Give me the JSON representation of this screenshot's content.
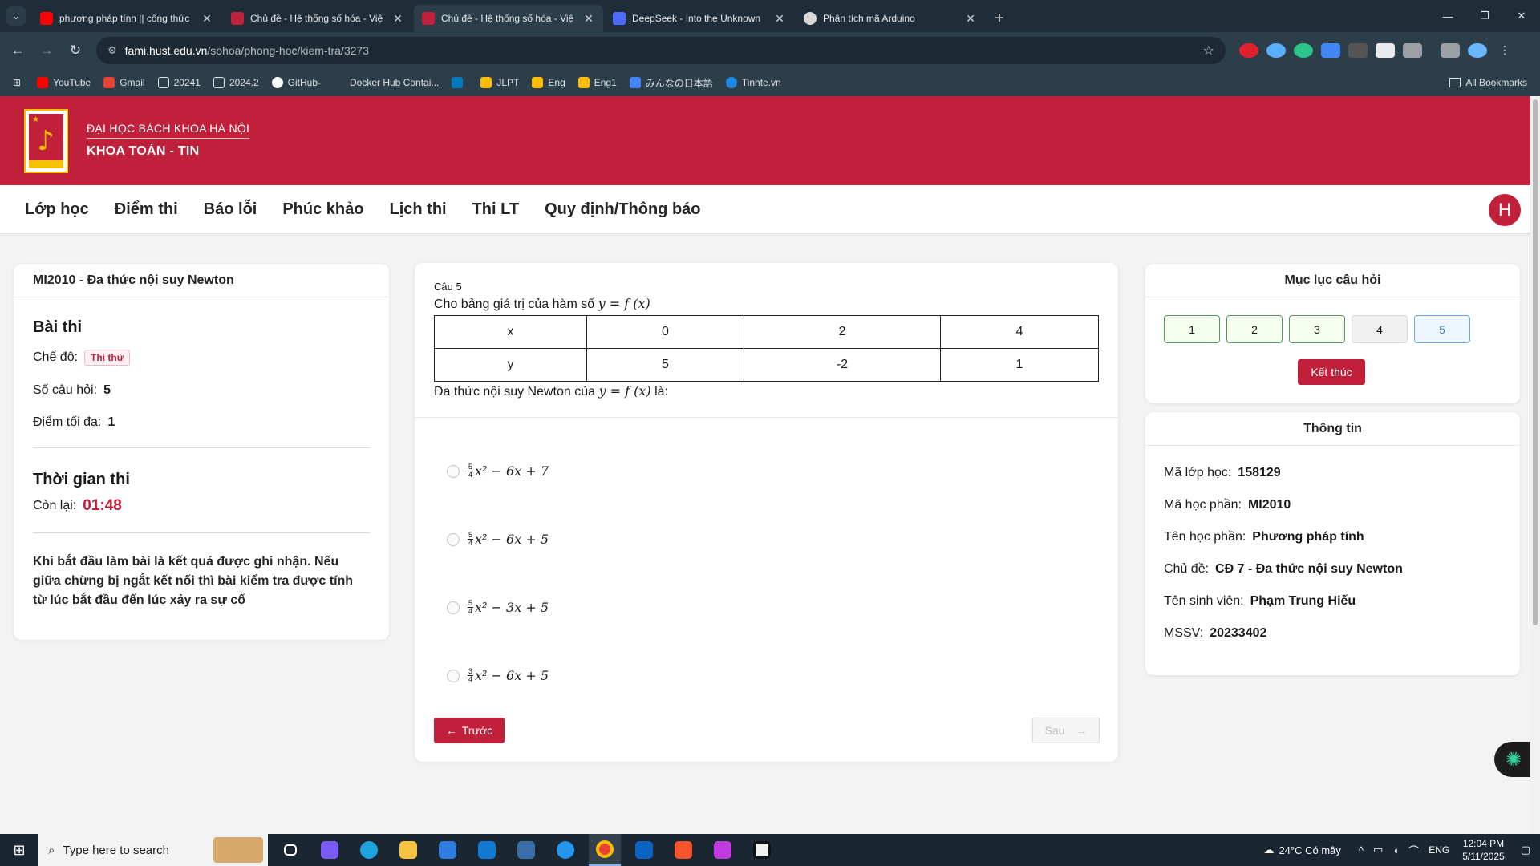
{
  "browser": {
    "tabs": [
      {
        "title": "phương pháp tính || công thức",
        "icon_color": "#ff0000",
        "active": false
      },
      {
        "title": "Chủ đề - Hệ thống số hóa - Việ",
        "icon_color": "#c0203a",
        "active": false
      },
      {
        "title": "Chủ đề - Hệ thống số hóa - Việ",
        "icon_color": "#c0203a",
        "active": true
      },
      {
        "title": "DeepSeek - Into the Unknown",
        "icon_color": "#4d6bfe",
        "active": false
      },
      {
        "title": "Phân tích mã Arduino",
        "icon_color": "#d9d9d9",
        "active": false
      }
    ],
    "url_host": "fami.hust.edu.vn",
    "url_path": "/sohoa/phong-hoc/kiem-tra/3273",
    "bookmarks": [
      {
        "label": "YouTube",
        "color": "#ff0000"
      },
      {
        "label": "Gmail",
        "color": "#ea4335"
      },
      {
        "label": "20241",
        "color": "#9aa0a6"
      },
      {
        "label": "2024.2",
        "color": "#9aa0a6"
      },
      {
        "label": "GitHub-",
        "color": "#ffffff"
      },
      {
        "label": "Docker Hub Contai...",
        "color": "#2d3e4b"
      },
      {
        "label": "",
        "color": "#0079bf"
      },
      {
        "label": "JLPT",
        "color": "#fbbc04"
      },
      {
        "label": "Eng",
        "color": "#fbbc04"
      },
      {
        "label": "Eng1",
        "color": "#fbbc04"
      },
      {
        "label": "みんなの日本語",
        "color": "#4285f4"
      },
      {
        "label": "Tinhte.vn",
        "color": "#1e88e5"
      }
    ],
    "all_bookmarks": "All Bookmarks"
  },
  "header": {
    "university": "ĐẠI HỌC BÁCH KHOA HÀ NỘI",
    "faculty": "KHOA TOÁN - TIN",
    "avatar_letter": "H"
  },
  "nav": [
    "Lớp học",
    "Điểm thi",
    "Báo lỗi",
    "Phúc khảo",
    "Lịch thi",
    "Thi LT",
    "Quy định/Thông báo"
  ],
  "exam": {
    "course_title": "MI2010 - Đa thức nội suy Newton",
    "section_exam": "Bài thi",
    "mode_label": "Chế độ:",
    "mode_value": "Thi thử",
    "count_label": "Số câu hỏi:",
    "count_value": "5",
    "max_label": "Điểm tối đa:",
    "max_value": "1",
    "section_time": "Thời gian thi",
    "remaining_label": "Còn lại:",
    "remaining_value": "01:48",
    "note": "Khi bắt đầu làm bài là kết quả được ghi nhận. Nếu giữa chừng bị ngắt kết nối thì bài kiểm tra được tính từ lúc bắt đầu đến lúc xảy ra sự cố"
  },
  "question": {
    "label": "Câu 5",
    "intro": "Cho bảng giá trị của hàm số",
    "fx": "y = f (x)",
    "table": [
      [
        "x",
        "0",
        "2",
        "4"
      ],
      [
        "y",
        "5",
        "-2",
        "1"
      ]
    ],
    "prompt_before": "Đa thức nội suy Newton của",
    "prompt_after": "là:",
    "options": [
      {
        "num": "5",
        "den": "4",
        "rest": "x² − 6x + 7"
      },
      {
        "num": "5",
        "den": "4",
        "rest": "x² − 6x + 5"
      },
      {
        "num": "5",
        "den": "4",
        "rest": "x² − 3x + 5"
      },
      {
        "num": "3",
        "den": "4",
        "rest": "x² − 6x + 5"
      }
    ],
    "prev_label": "Trước",
    "next_label": "Sau"
  },
  "toc": {
    "title": "Mục lục câu hỏi",
    "buttons": [
      "1",
      "2",
      "3",
      "4",
      "5"
    ],
    "end_label": "Kết thúc"
  },
  "info": {
    "title": "Thông tin",
    "rows": [
      {
        "label": "Mã lớp học:",
        "value": "158129"
      },
      {
        "label": "Mã học phần:",
        "value": "MI2010"
      },
      {
        "label": "Tên học phần:",
        "value": "Phương pháp tính"
      },
      {
        "label": "Chủ đề:",
        "value": "CĐ 7 - Đa thức nội suy Newton"
      },
      {
        "label": "Tên sinh viên:",
        "value": "Phạm Trung Hiếu"
      },
      {
        "label": "MSSV:",
        "value": "20233402"
      }
    ]
  },
  "taskbar": {
    "search_placeholder": "Type here to search",
    "weather": "24°C  Có mây",
    "lang": "ENG",
    "time": "12:04 PM",
    "date": "5/11/2025"
  }
}
